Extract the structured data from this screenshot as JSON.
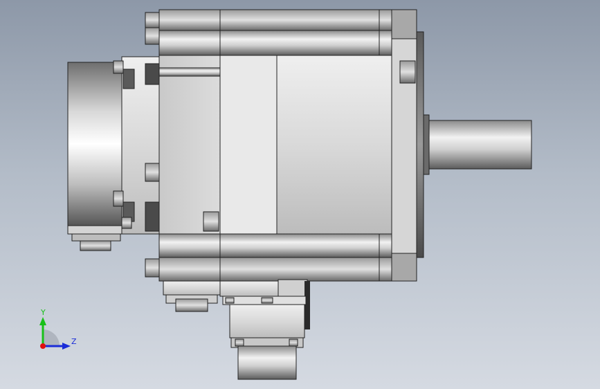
{
  "viewport": {
    "background_top": "#8d98a8",
    "background_bottom": "#d5dae2"
  },
  "triad": {
    "y_label": "Y",
    "z_label": "Z",
    "y_color": "#18c018",
    "z_color": "#1a2cd8",
    "x_color": "#e01010"
  },
  "model": {
    "name_icon": "servo-motor-gearbox-side-view"
  }
}
